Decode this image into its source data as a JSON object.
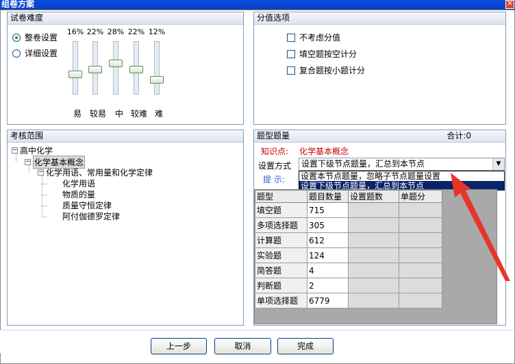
{
  "window": {
    "title": "组卷方案",
    "close": "✕"
  },
  "difficulty": {
    "header": "试卷难度",
    "radios": [
      {
        "label": "整卷设置",
        "checked": true
      },
      {
        "label": "详细设置",
        "checked": false
      }
    ],
    "sliders": [
      {
        "pct": "16%",
        "label": "易",
        "level": 0.16
      },
      {
        "pct": "22%",
        "label": "较易",
        "level": 0.22
      },
      {
        "pct": "28%",
        "label": "中",
        "level": 0.28
      },
      {
        "pct": "22%",
        "label": "较难",
        "level": 0.22
      },
      {
        "pct": "12%",
        "label": "难",
        "level": 0.12
      }
    ]
  },
  "score": {
    "header": "分值选项",
    "options": [
      "不考虑分值",
      "填空题按空计分",
      "复合题按小题计分"
    ]
  },
  "scope": {
    "header": "考核范围",
    "tree": {
      "root": "高中化学",
      "child": "化学基本概念",
      "grandchild": "化学用语、常用量和化学定律",
      "leaves": [
        "化学用语",
        "物质的量",
        "质量守恒定律",
        "阿付伽德罗定律"
      ]
    }
  },
  "questions": {
    "header": "题型题量",
    "total": "合计:0",
    "knowledge_label": "知识点:",
    "knowledge_value": "化学基本概念",
    "method_label": "设置方式",
    "method_value": "设置下级节点题量，汇总到本节点",
    "hint_label": "提  示:",
    "dropdown_options": [
      {
        "label": "设置本节点题量，忽略子节点题量设置",
        "selected": false
      },
      {
        "label": "设置下级节点题量，汇总到本节点",
        "selected": true
      }
    ],
    "columns": [
      "题型",
      "题目数量",
      "设置题数",
      "单题分"
    ],
    "rows": [
      {
        "type": "填空题",
        "count": "715"
      },
      {
        "type": "多项选择题",
        "count": "305"
      },
      {
        "type": "计算题",
        "count": "612"
      },
      {
        "type": "实验题",
        "count": "124"
      },
      {
        "type": "简答题",
        "count": "4"
      },
      {
        "type": "判断题",
        "count": "2"
      },
      {
        "type": "单项选择题",
        "count": "6779"
      }
    ]
  },
  "buttons": {
    "prev": "上一步",
    "cancel": "取消",
    "finish": "完成"
  },
  "colors": {
    "title_bar": "#0a4ee0",
    "red_label": "#cc0000",
    "hint_blue": "#2a5bd7",
    "arrow_red": "#e8352a",
    "selection": "#0a246a"
  },
  "icons": {
    "close": "close-icon",
    "dropdown": "chevron-down-icon",
    "arrow": "annotation-arrow"
  }
}
